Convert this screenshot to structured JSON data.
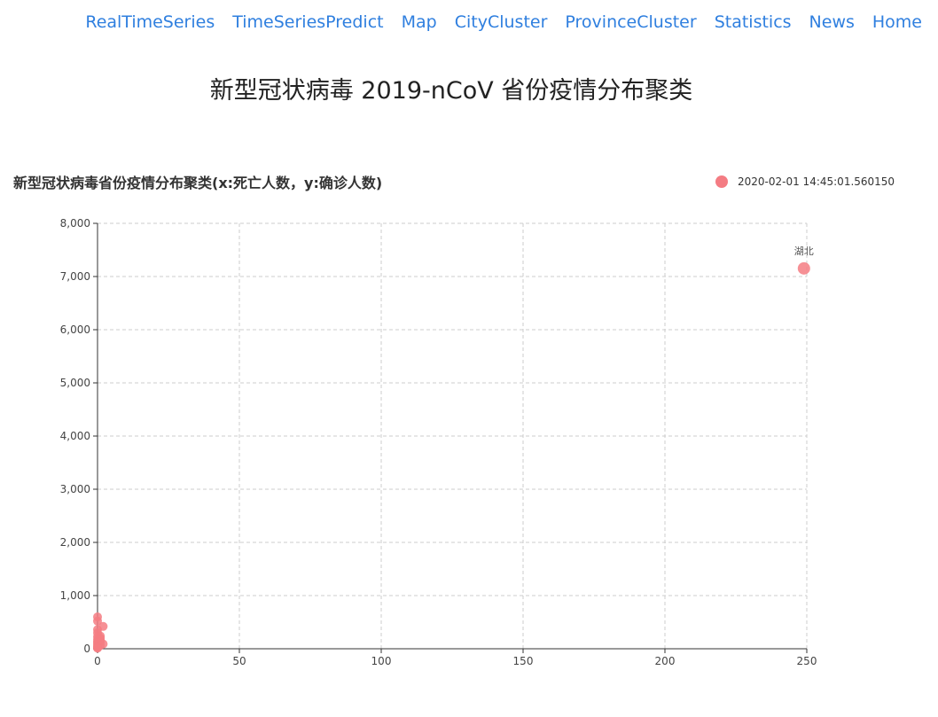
{
  "nav": {
    "items": [
      "RealTimeSeries",
      "TimeSeriesPredict",
      "Map",
      "CityCluster",
      "ProvinceCluster",
      "Statistics",
      "News",
      "Home"
    ]
  },
  "page": {
    "title": "新型冠状病毒 2019-nCoV 省份疫情分布聚类"
  },
  "chart_data": {
    "type": "scatter",
    "title": "新型冠状病毒省份疫情分布聚类(x:死亡人数，y:确诊人数)",
    "xlabel": "",
    "ylabel": "",
    "xlim": [
      0,
      250
    ],
    "ylim": [
      0,
      8000
    ],
    "x_ticks": [
      0,
      50,
      100,
      150,
      200,
      250
    ],
    "y_ticks": [
      0,
      1000,
      2000,
      3000,
      4000,
      5000,
      6000,
      7000,
      8000
    ],
    "x_tick_labels": [
      "0",
      "50",
      "100",
      "150",
      "200",
      "250"
    ],
    "y_tick_labels": [
      "0",
      "1,000",
      "2,000",
      "3,000",
      "4,000",
      "5,000",
      "6,000",
      "7,000",
      "8,000"
    ],
    "grid": true,
    "legend_placement": "top-right",
    "color": "#f47c83",
    "series": [
      {
        "name": "2020-02-01 14:45:01.560150",
        "points": [
          {
            "x": 249,
            "y": 7153,
            "label": "湖北"
          },
          {
            "x": 0,
            "y": 599
          },
          {
            "x": 0,
            "y": 520
          },
          {
            "x": 0,
            "y": 360
          },
          {
            "x": 0,
            "y": 300
          },
          {
            "x": 1,
            "y": 240
          },
          {
            "x": 0,
            "y": 230
          },
          {
            "x": 1,
            "y": 200
          },
          {
            "x": 0,
            "y": 180
          },
          {
            "x": 1,
            "y": 160
          },
          {
            "x": 0,
            "y": 140
          },
          {
            "x": 1,
            "y": 130
          },
          {
            "x": 0,
            "y": 110
          },
          {
            "x": 2,
            "y": 90
          },
          {
            "x": 0,
            "y": 80
          },
          {
            "x": 1,
            "y": 60
          },
          {
            "x": 0,
            "y": 50
          },
          {
            "x": 0,
            "y": 30
          },
          {
            "x": 0,
            "y": 20
          },
          {
            "x": 0,
            "y": 10
          },
          {
            "x": 2,
            "y": 420
          }
        ]
      }
    ]
  }
}
